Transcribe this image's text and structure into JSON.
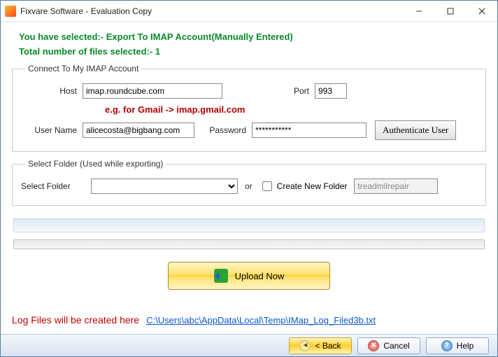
{
  "window": {
    "title": "Fixvare Software - Evaluation Copy"
  },
  "info": {
    "line1": "You have selected:- Export To IMAP Account(Manually Entered)",
    "line2": "Total number of files selected:- 1"
  },
  "imap_group": {
    "legend": "Connect To My IMAP Account",
    "host_label": "Host",
    "host_value": "imap.roundcube.com",
    "port_label": "Port",
    "port_value": "993",
    "hint": "e.g. for Gmail -> imap.gmail.com",
    "user_label": "User Name",
    "user_value": "alicecosta@bigbang.com",
    "pass_label": "Password",
    "pass_value": "***********",
    "auth_button": "Authenticate User"
  },
  "folder_group": {
    "legend": "Select Folder (Used while exporting)",
    "select_label": "Select Folder",
    "or_label": "or",
    "create_label": "Create New Folder",
    "new_folder_value": "treadmilrepair"
  },
  "upload": {
    "label": "Upload Now"
  },
  "log": {
    "label": "Log Files will be created here",
    "path": "C:\\Users\\abc\\AppData\\Local\\Temp\\IMap_Log_Filed3b.txt"
  },
  "footer": {
    "back": "< Back",
    "cancel": "Cancel",
    "help": "Help"
  }
}
